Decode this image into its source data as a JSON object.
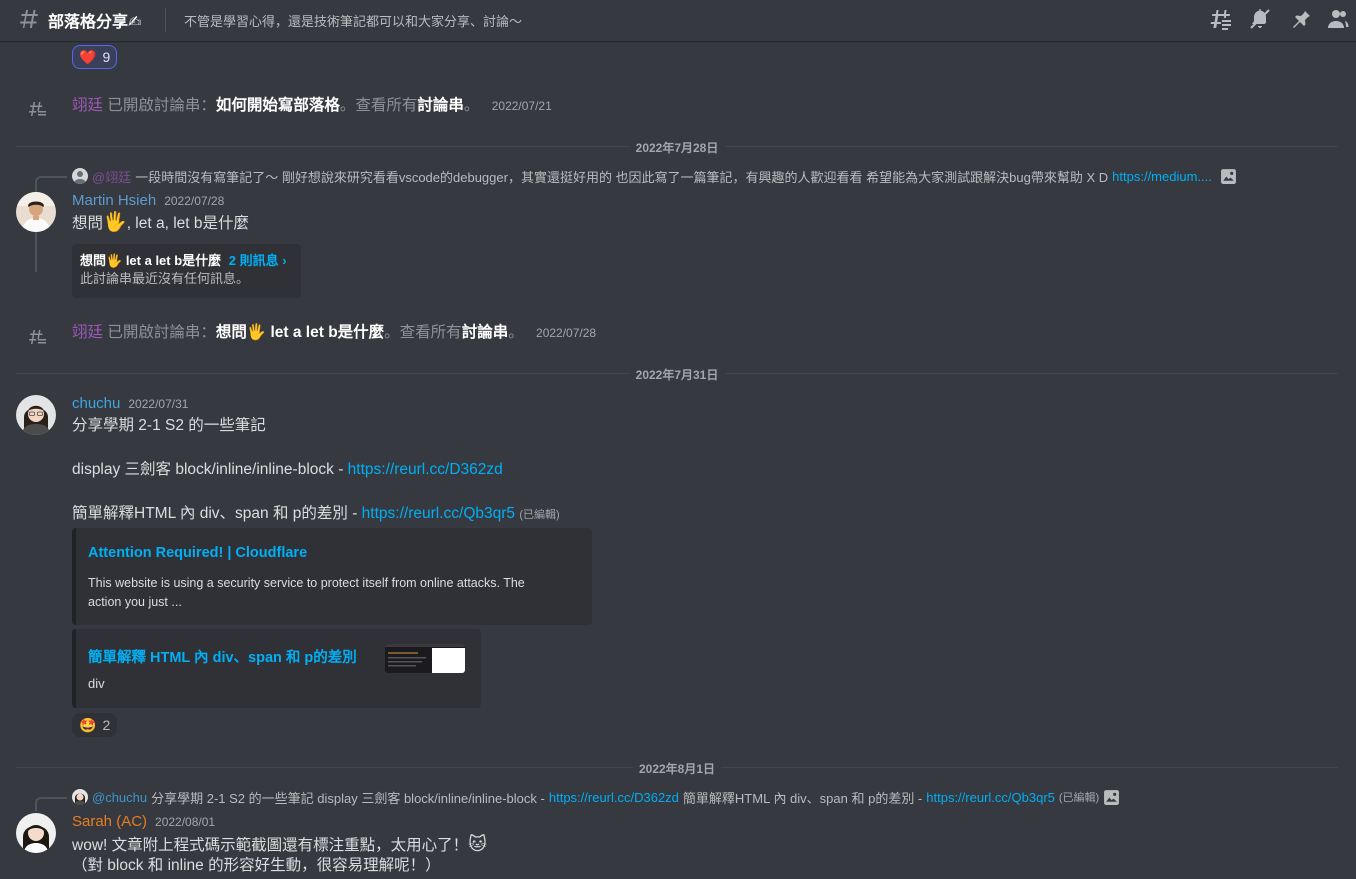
{
  "header": {
    "title": "部落格分享✍",
    "topic": "不管是學習心得，還是技術筆記都可以和大家分享、討論～"
  },
  "top_reaction": {
    "emoji": "❤️",
    "count": "9"
  },
  "system1": {
    "user": "翊廷",
    "action": "已開啟討論串：",
    "thread": "如何開始寫部落格",
    "see_all_pre": "。查看所有",
    "see_all_link": "討論串",
    "see_all_post": "。",
    "time": "2022/07/21"
  },
  "date1": "2022年7月28日",
  "msg_martin": {
    "reply": {
      "mention": "@翊廷",
      "text": "一段時間沒有寫筆記了～ 剛好想說來研究看看vscode的debugger，其實還挺好用的 也因此寫了一篇筆記，有興趣的人歡迎看看 希望能為大家測試跟解決bug帶來幫助 X D",
      "link": "https://medium...."
    },
    "user": "Martin Hsieh",
    "user_color": "#5e9bd1",
    "time": "2022/07/28",
    "text_pre": "想問",
    "emoji": "🖐",
    "text_post": ", let a, let b是什麼",
    "thread": {
      "name_pre": "想問",
      "emoji": "🖐",
      "name_post": " let a let b是什麼",
      "count": "2 則訊息 ›",
      "sub": "此討論串最近沒有任何訊息。"
    }
  },
  "system2": {
    "user": "翊廷",
    "action": "已開啟討論串：",
    "thread_pre": "想問",
    "emoji": "🖐",
    "thread_post": " let a let b是什麼",
    "see_all_pre": "。查看所有",
    "see_all_link": "討論串",
    "see_all_post": "。",
    "time": "2022/07/28"
  },
  "date2": "2022年7月31日",
  "msg_chuchu": {
    "user": "chuchu",
    "user_color": "#3ba7e3",
    "time": "2022/07/31",
    "line1": "分享學期 2-1  S2 的一些筆記",
    "line2_pre": "display 三劍客 block/inline/inline-block - ",
    "line2_link": "https://reurl.cc/D362zd",
    "line3_pre": "簡單解釋HTML 內 div、span 和 p的差別 - ",
    "line3_link": "https://reurl.cc/Qb3qr5",
    "edited": "(已編輯)",
    "embed1": {
      "title": "Attention Required! | Cloudflare",
      "desc_line1": "This website is using a security service to protect itself from online attacks. The",
      "desc_line2": "action you just ..."
    },
    "embed2": {
      "title": "簡單解釋 HTML 內 div、span 和 p的差別",
      "desc": "div"
    },
    "reaction": {
      "emoji": "🤩",
      "count": "2"
    }
  },
  "date3": "2022年8月1日",
  "msg_sarah": {
    "reply": {
      "mention": "@chuchu",
      "text_a": "分享學期 2-1  S2 的一些筆記  display 三劍客 block/inline/inline-block - ",
      "link_a": "https://reurl.cc/D362zd",
      "text_b": "  簡單解釋HTML 內 div、span 和 p的差別 - ",
      "link_b": "https://reurl.cc/Qb3qr5",
      "edited": "(已編輯)"
    },
    "user": "Sarah (AC)",
    "user_color": "#e67e22",
    "time": "2022/08/01",
    "line1": "wow! 文章附上程式碼示範截圖還有標注重點，太用心了！",
    "emoji": "🐱",
    "line2": "（對 block 和 inline 的形容好生動，很容易理解呢！）"
  },
  "colors": {
    "bg": "#36393f",
    "embed_bg": "#2f3136",
    "link": "#00aff4",
    "system_user": "#9b59b6",
    "blurple": "#5865f2"
  },
  "icons": [
    "hash-icon",
    "threads-icon",
    "mute-bell-icon",
    "pin-icon",
    "members-icon",
    "image-icon"
  ]
}
